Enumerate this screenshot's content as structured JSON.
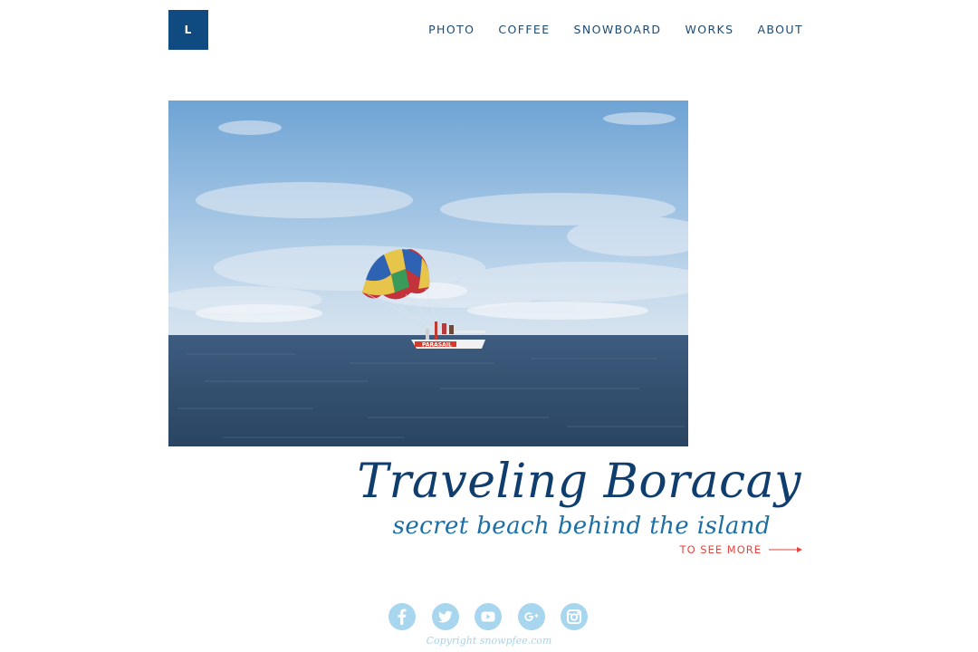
{
  "header": {
    "logo_text": "L",
    "nav": [
      {
        "label": "PHOTO"
      },
      {
        "label": "COFFEE"
      },
      {
        "label": "SNOWBOARD"
      },
      {
        "label": "WORKS"
      },
      {
        "label": "ABOUT"
      }
    ]
  },
  "hero": {
    "image_icon": "parasail-photo",
    "boat_sign": "PARASAIL"
  },
  "post": {
    "title": "Traveling Boracay",
    "subtitle": "secret beach behind the island",
    "see_more_label": "TO SEE MORE"
  },
  "footer": {
    "socials": [
      {
        "icon": "facebook-icon"
      },
      {
        "icon": "twitter-icon"
      },
      {
        "icon": "youtube-icon"
      },
      {
        "icon": "google-plus-icon"
      },
      {
        "icon": "instagram-icon"
      }
    ],
    "copyright": "Copyright snowpfee.com"
  },
  "colors": {
    "brand": "#0f4a80",
    "nav_text": "#1d4a72",
    "title": "#0f3e6e",
    "subtitle": "#1c6ea4",
    "accent": "#e5453d",
    "social": "#a7d6ee"
  }
}
